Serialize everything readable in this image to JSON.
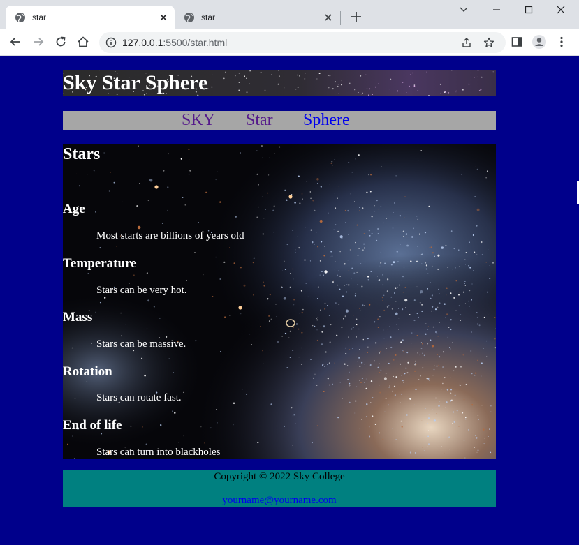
{
  "browser": {
    "tabs": [
      {
        "title": "star",
        "active": true
      },
      {
        "title": "star",
        "active": false
      }
    ],
    "url": {
      "host": "127.0.0.1",
      "rest": ":5500/star.html"
    }
  },
  "page": {
    "site_title": "Sky Star Sphere",
    "nav": [
      {
        "label": "SKY",
        "state": "visited"
      },
      {
        "label": "Star",
        "state": "visited"
      },
      {
        "label": "Sphere",
        "state": "unvisited"
      }
    ],
    "heading": "Stars",
    "sections": [
      {
        "title": "Age",
        "text": "Most starts are billions of years old"
      },
      {
        "title": "Temperature",
        "text": "Stars can be very hot."
      },
      {
        "title": "Mass",
        "text": "Stars can be massive."
      },
      {
        "title": "Rotation",
        "text": "Stars can rotate fast."
      },
      {
        "title": "End of life",
        "text": "Stars can turn into blackholes"
      }
    ],
    "footer": {
      "copyright": "Copyright © 2022 Sky College",
      "email": "yourname@yourname.com"
    }
  },
  "colors": {
    "page_background": "#00008b",
    "nav_background": "#a6a6a6",
    "footer_background": "#008080",
    "visited_link": "#551a8b",
    "unvisited_link": "#0000ee"
  }
}
